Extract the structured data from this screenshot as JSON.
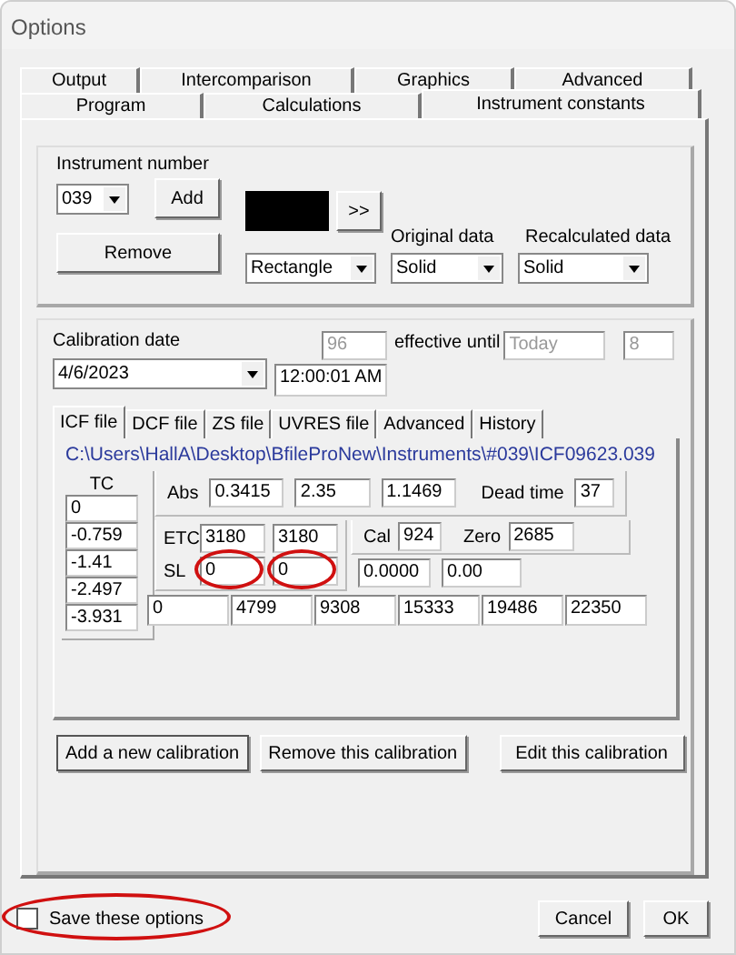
{
  "window": {
    "title": "Options"
  },
  "tab_rows": [
    {
      "tabs": [
        {
          "label": "Output",
          "selected": false
        },
        {
          "label": "Intercomparison",
          "selected": false
        },
        {
          "label": "Graphics",
          "selected": false
        },
        {
          "label": "Advanced",
          "selected": false
        }
      ]
    },
    {
      "tabs": [
        {
          "label": "Program",
          "selected": false
        },
        {
          "label": "Calculations",
          "selected": false
        },
        {
          "label": "Instrument constants",
          "selected": true
        }
      ]
    }
  ],
  "instrument": {
    "label": "Instrument number",
    "number": "039",
    "add_button": "Add",
    "remove_button": "Remove",
    "more_button": ">>",
    "original_label": "Original data",
    "recalculated_label": "Recalculated data",
    "shape": "Rectangle",
    "original_style": "Solid",
    "recalculated_style": "Solid"
  },
  "calibration": {
    "label": "Calibration date",
    "date": "4/6/2023",
    "time": "12:00:01 AM",
    "days": {
      "value": "96",
      "disabled": true
    },
    "effective_label": "effective until",
    "until": {
      "value": "Today",
      "disabled": true
    },
    "count": {
      "value": "8",
      "disabled": true
    }
  },
  "file_tabs": [
    {
      "label": "ICF file",
      "selected": true
    },
    {
      "label": "DCF file",
      "selected": false
    },
    {
      "label": "ZS file",
      "selected": false
    },
    {
      "label": "UVRES file",
      "selected": false
    },
    {
      "label": "Advanced",
      "selected": false
    },
    {
      "label": "History",
      "selected": false
    }
  ],
  "icf": {
    "path": "C:\\Users\\HallA\\Desktop\\BfileProNew\\Instruments\\#039\\ICF09623.039",
    "tc_label": "TC",
    "tc": [
      "0",
      "-0.759",
      "-1.41",
      "-2.497",
      "-3.931"
    ],
    "abs_label": "Abs",
    "abs": [
      "0.3415",
      "2.35",
      "1.1469"
    ],
    "dead_time_label": "Dead time",
    "dead_time": "37",
    "etc_label": "ETC",
    "etc": [
      "3180",
      "3180"
    ],
    "cal_label": "Cal",
    "cal": "924",
    "zero_label": "Zero",
    "zero": "2685",
    "sl_label": "SL",
    "sl": [
      {
        "value": "0",
        "circled": true
      },
      {
        "value": "0",
        "circled": true
      }
    ],
    "extra": [
      "0.0000",
      "0.00"
    ],
    "counts": [
      "0",
      "4799",
      "9308",
      "15333",
      "19486",
      "22350"
    ]
  },
  "calibration_buttons": [
    {
      "label": "Add a new calibration",
      "default": true
    },
    {
      "label": "Remove this calibration",
      "default": false
    },
    {
      "label": "Edit this calibration",
      "default": false
    }
  ],
  "save_options": {
    "label": "Save these options",
    "checked": false,
    "circled": true
  },
  "buttons": [
    "Cancel",
    "OK"
  ]
}
